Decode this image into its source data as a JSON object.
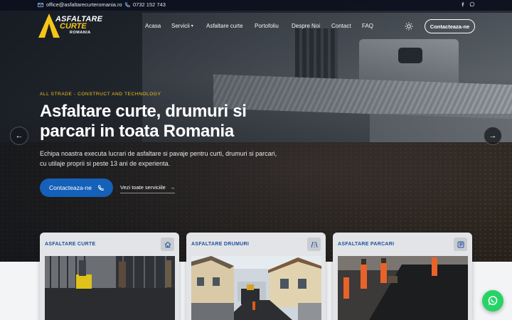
{
  "topbar": {
    "email": "office@asfaltarecurteromania.ro",
    "phone": "0732 152 743",
    "social": [
      "facebook-icon",
      "whatsapp-icon"
    ]
  },
  "logo": {
    "line1": "ASFALTARE",
    "line2": "CURTE",
    "line3": "ROMANIA"
  },
  "nav": {
    "items": [
      {
        "label": "Acasa"
      },
      {
        "label": "Servicii",
        "has_dropdown": true
      },
      {
        "label": "Asfaltare curte"
      },
      {
        "label": "Portofoliu"
      },
      {
        "label": "Despre Noi"
      },
      {
        "label": "Contact"
      },
      {
        "label": "FAQ"
      }
    ],
    "theme_toggle": "sun-icon",
    "cta_label": "Contacteaza-ne"
  },
  "hero": {
    "tagline": "ALL STRADE - CONSTRUCT AND TECHNOLOGY",
    "headline": "Asfaltare curte, drumuri si parcari in toata Romania",
    "subtext": "Echipa noastra executa lucrari de asfaltare si pavaje pentru curti, drumuri si parcari, cu utilaje proprii si peste 13 ani de experienta.",
    "primary_button": "Contacteaza-ne",
    "secondary_link": "Vezi toate serviciile",
    "prev_icon": "arrow-left-icon",
    "next_icon": "arrow-right-icon"
  },
  "services": [
    {
      "title": "ASFALTARE CURTE",
      "icon": "house-icon"
    },
    {
      "title": "ASFALTARE DRUMURI",
      "icon": "road-icon"
    },
    {
      "title": "ASFALTARE PARCARI",
      "icon": "parking-icon"
    }
  ],
  "colors": {
    "accent": "#f5c518",
    "primary": "#1560b8",
    "card_title": "#1e4f9a",
    "whatsapp": "#25d366"
  },
  "floating": {
    "icon": "whatsapp-icon"
  }
}
